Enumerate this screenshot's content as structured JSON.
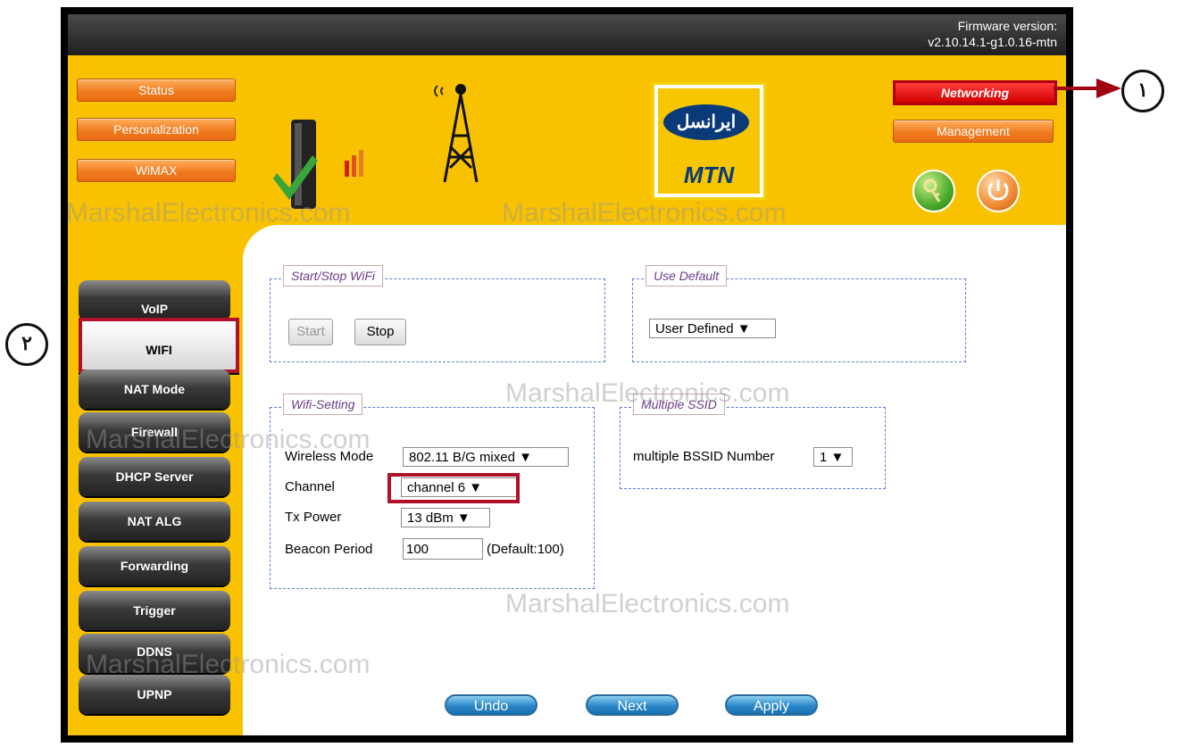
{
  "header": {
    "firmware_label": "Firmware version:",
    "firmware_value": "v2.10.14.1-g1.0.16-mtn"
  },
  "left_nav": [
    "Status",
    "Personalization",
    "WiMAX"
  ],
  "right_nav": {
    "active": "Networking",
    "management": "Management"
  },
  "logo": {
    "persian": "ایرانسل",
    "brand": "MTN"
  },
  "watermark": "MarshalElectronics.com",
  "sidebar": {
    "items": [
      {
        "label": "VoIP"
      },
      {
        "label": "WIFI"
      },
      {
        "label": "NAT Mode"
      },
      {
        "label": "Firewall"
      },
      {
        "label": "DHCP Server"
      },
      {
        "label": "NAT ALG"
      },
      {
        "label": "Forwarding"
      },
      {
        "label": "Trigger"
      },
      {
        "label": "DDNS"
      },
      {
        "label": "UPNP"
      }
    ],
    "active_index": 1
  },
  "startstop": {
    "title": "Start/Stop WiFi",
    "start": "Start",
    "stop": "Stop"
  },
  "use_default": {
    "title": "Use Default",
    "selected": "User Defined ▼"
  },
  "wifi_setting": {
    "title": "Wifi-Setting",
    "wireless_mode_label": "Wireless Mode",
    "wireless_mode_value": "802.11 B/G mixed ▼",
    "channel_label": "Channel",
    "channel_value": "channel 6 ▼",
    "tx_power_label": "Tx Power",
    "tx_power_value": "13 dBm ▼",
    "beacon_label": "Beacon Period",
    "beacon_value": "100",
    "beacon_default": "(Default:100)"
  },
  "multiple_ssid": {
    "title": "Multiple SSID",
    "label": "multiple BSSID Number",
    "value": "1 ▼"
  },
  "actions": {
    "undo": "Undo",
    "next": "Next",
    "apply": "Apply"
  },
  "callouts": {
    "one": "۱",
    "two": "۲"
  },
  "colors": {
    "background": "#f8c200",
    "highlight": "#b0102a",
    "button_orange": "#f07c20",
    "button_blue": "#2b86c8"
  }
}
